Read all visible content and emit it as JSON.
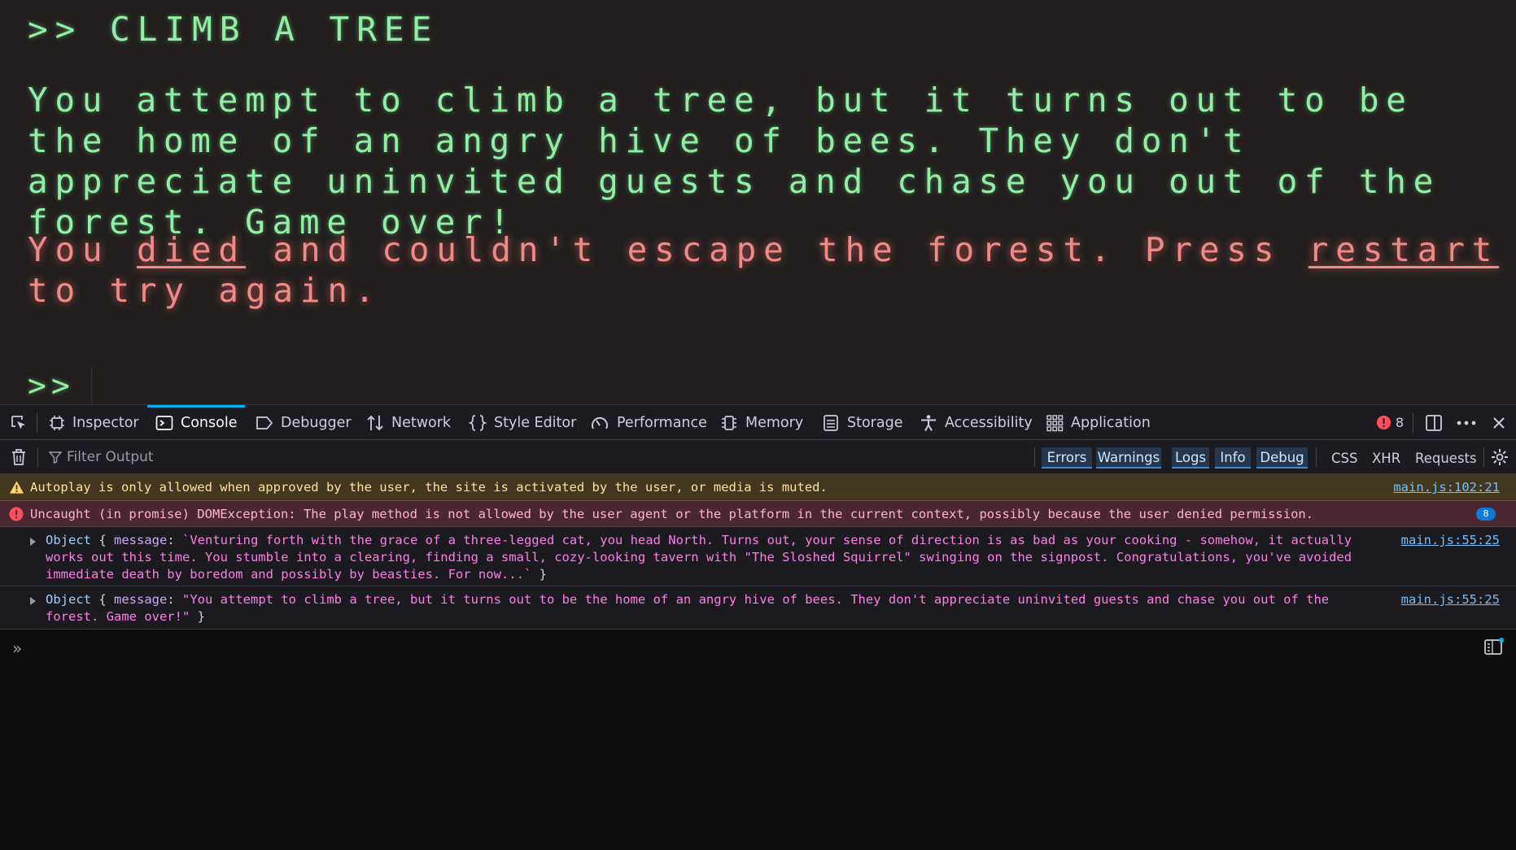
{
  "game": {
    "command": ">> CLIMB A TREE",
    "narration": "You attempt to climb a tree, but it turns out to be the home of an angry hive of bees. They don't appreciate uninvited guests and chase you out of the forest. Game over!",
    "death": {
      "prefix": "You ",
      "died": "died",
      "middle": " and couldn't escape the forest. Press ",
      "restart": "restart",
      "suffix": " to try again."
    },
    "prompt": ">>",
    "text_color": "#8ff0a4",
    "death_color": "#f08a86"
  },
  "devtools": {
    "tabs": [
      {
        "label": "Inspector",
        "icon": "inspector-icon"
      },
      {
        "label": "Console",
        "icon": "console-icon",
        "selected": true
      },
      {
        "label": "Debugger",
        "icon": "debugger-icon"
      },
      {
        "label": "Network",
        "icon": "network-icon"
      },
      {
        "label": "Style Editor",
        "icon": "braces-icon"
      },
      {
        "label": "Performance",
        "icon": "gauge-icon"
      },
      {
        "label": "Memory",
        "icon": "memory-chip-icon"
      },
      {
        "label": "Storage",
        "icon": "storage-icon"
      },
      {
        "label": "Accessibility",
        "icon": "accessibility-icon"
      },
      {
        "label": "Application",
        "icon": "grid-icon"
      }
    ],
    "error_count": "8",
    "filter_placeholder": "Filter Output",
    "filters": [
      "Errors",
      "Warnings",
      "Logs",
      "Info",
      "Debug"
    ],
    "extra_filters": [
      "CSS",
      "XHR",
      "Requests"
    ],
    "accent": "#00b3f4"
  },
  "console": {
    "warning": {
      "text": "Autoplay is only allowed when approved by the user, the site is activated by the user, or media is muted.",
      "source": "main.js:102:21"
    },
    "error": {
      "text": "Uncaught (in promise) DOMException: The play method is not allowed by the user agent or the platform in the current context, possibly because the user denied permission.",
      "count": "8"
    },
    "logs": [
      {
        "object": "Object",
        "open": "{ ",
        "key": "message",
        "value": "`Venturing forth with the grace of a three-legged cat, you head North. Turns out, your sense of direction is as bad as your cooking - somehow, it actually works out this time. You stumble into a clearing, finding a small, cozy-looking tavern with \"The Sloshed Squirrel\" swinging on the signpost. Congratulations, you've avoided immediate death by boredom and possibly by beasties. For now...`",
        "close": " }",
        "source": "main.js:55:25"
      },
      {
        "object": "Object",
        "open": "{ ",
        "key": "message",
        "value": "\"You attempt to climb a tree, but it turns out to be the home of an angry hive of bees. They don't appreciate uninvited guests and chase you out of the forest. Game over!\"",
        "close": " }",
        "source": "main.js:55:25"
      }
    ],
    "input_prompt": "»"
  }
}
